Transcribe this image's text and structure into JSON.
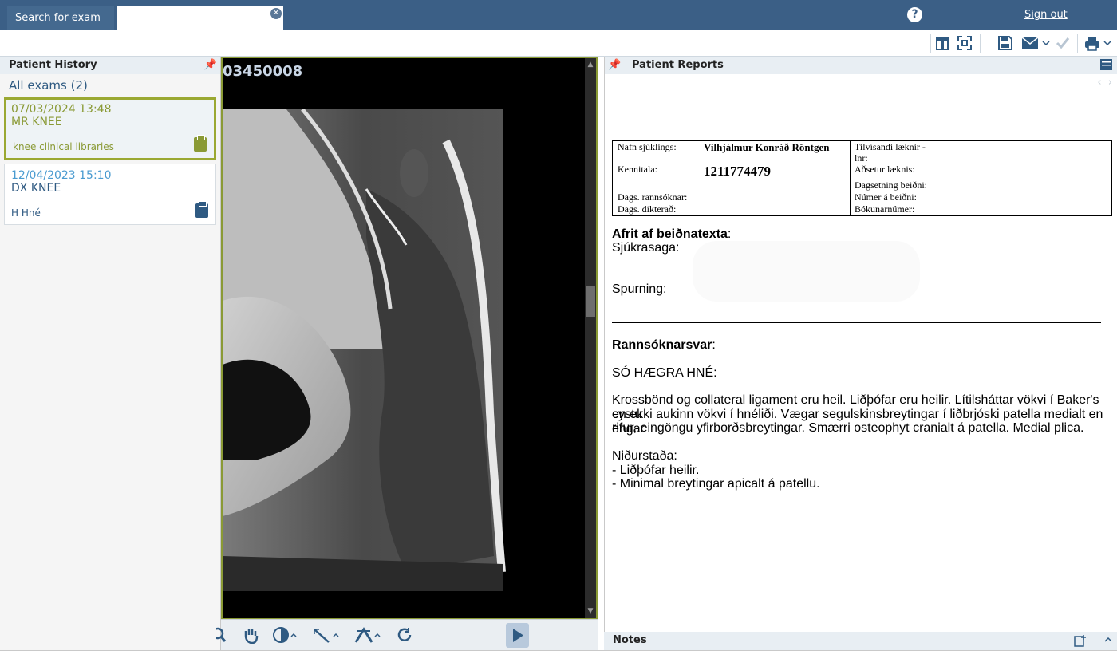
{
  "topbar": {
    "tabs": [
      {
        "label": "Search for exam"
      },
      {
        "label": ""
      }
    ],
    "help_label": "?",
    "signout_label": "Sign out"
  },
  "left_panel": {
    "title": "Patient History",
    "all_exams_label": "All exams (2)",
    "exams": [
      {
        "datetime": "07/03/2024 13:48",
        "modality": "MR KNEE",
        "description": "knee clinical libraries",
        "color": "#8a9a35"
      },
      {
        "datetime": "12/04/2023 15:10",
        "modality": "DX KNEE",
        "description": "H Hné",
        "color": "#2f5a82"
      }
    ]
  },
  "viewer": {
    "accession": "03450008",
    "scroll_position": 0.44
  },
  "right_panel": {
    "title": "Patient Reports",
    "report": {
      "table": {
        "patient_name_label": "Nafn sjúklings:",
        "patient_name": "Vilhjálmur Konráð Röntgen",
        "ssn_label": "Kennitala:",
        "ssn": "1211774479",
        "exam_date_label": "Dags. rannsóknar:",
        "dictated_label": "Dags. dikterað:",
        "referring_label": "Tilvísandi læknir -",
        "referring_label2": "lnr:",
        "doctor_location_label": "Aðsetur læknis:",
        "request_date_label": "Dagsetning beiðni:",
        "request_no_label": "Númer á beiðni:",
        "booking_no_label": "Bókunarnúmer:"
      },
      "request_heading": "Afrit af beiðnatexta",
      "request_colon": ":",
      "history_label": "Sjúkrasaga:",
      "question_label": "Spurning:",
      "answer_heading": "Rannsóknarsvar",
      "answer_colon": ":",
      "findings_title": "SÓ HÆGRA HNÉ:",
      "findings_line1": "Krossbönd og collateral ligament eru heil. Liðþófar eru heilir. Lítilsháttar vökvi í Baker's cystu",
      "findings_line2": "en ekki aukinn vökvi í hnéliði. Vægar segulskinsbreytingar í liðbrjóski patella medialt en engar",
      "findings_line3": "rifur, eingöngu yfirborðsbreytingar. Smærri osteophyt craniалт á patella. Medial plica.",
      "conclusion_label": "Niðurstaða:",
      "conclusion_1": "- Liðþófar heilir.",
      "conclusion_2": "- Minimal breytingar apicalt á patellu."
    },
    "notes_label": "Notes"
  }
}
